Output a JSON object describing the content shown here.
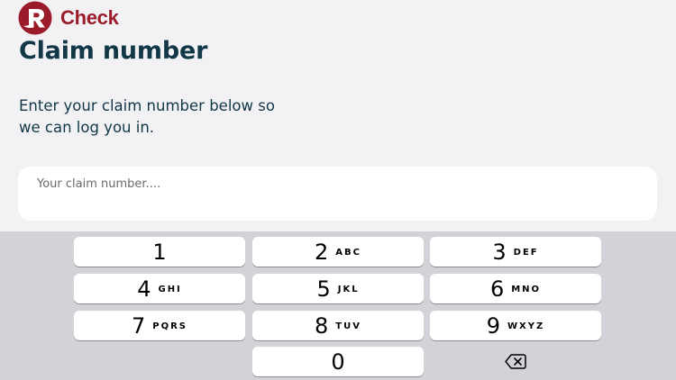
{
  "app": {
    "logo_text": "Check",
    "brand_color": "#9b1b2b",
    "title": "Claim number",
    "instructions": "Enter your claim number below so we can log you in."
  },
  "claim_input": {
    "placeholder": "Your claim number....",
    "value": ""
  },
  "keyboard": {
    "keys": [
      {
        "digit": "1",
        "letters": ""
      },
      {
        "digit": "2",
        "letters": "ABC"
      },
      {
        "digit": "3",
        "letters": "DEF"
      },
      {
        "digit": "4",
        "letters": "GHI"
      },
      {
        "digit": "5",
        "letters": "JKL"
      },
      {
        "digit": "6",
        "letters": "MNO"
      },
      {
        "digit": "7",
        "letters": "PQRS"
      },
      {
        "digit": "8",
        "letters": "TUV"
      },
      {
        "digit": "9",
        "letters": "WXYZ"
      },
      {
        "digit": "0",
        "letters": ""
      }
    ],
    "delete_icon": "backspace-icon"
  }
}
